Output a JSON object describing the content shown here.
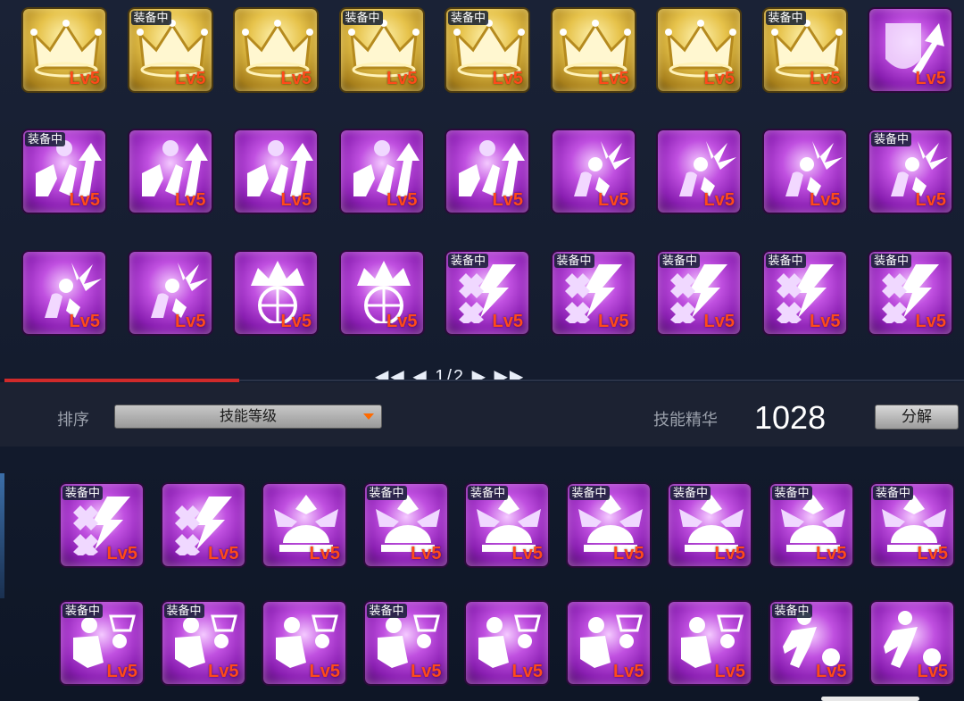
{
  "top_grid": {
    "rows": [
      [
        {
          "style": "gold",
          "icon": "crown-icon",
          "level": "Lv5",
          "equipped": false
        },
        {
          "style": "gold",
          "icon": "crown-icon",
          "level": "Lv5",
          "equipped": true
        },
        {
          "style": "gold",
          "icon": "crown-icon",
          "level": "Lv5",
          "equipped": false
        },
        {
          "style": "gold",
          "icon": "crown-icon",
          "level": "Lv5",
          "equipped": true
        },
        {
          "style": "gold",
          "icon": "crown-icon",
          "level": "Lv5",
          "equipped": true
        },
        {
          "style": "gold",
          "icon": "crown-icon",
          "level": "Lv5",
          "equipped": false
        },
        {
          "style": "gold",
          "icon": "crown-icon",
          "level": "Lv5",
          "equipped": false
        },
        {
          "style": "gold",
          "icon": "crown-icon",
          "level": "Lv5",
          "equipped": true
        },
        {
          "style": "purple",
          "icon": "shield-arrow-icon",
          "level": "Lv5",
          "equipped": false
        }
      ],
      [
        {
          "style": "purple",
          "icon": "rebound-up-icon",
          "level": "Lv5",
          "equipped": true
        },
        {
          "style": "purple",
          "icon": "rebound-up-icon",
          "level": "Lv5",
          "equipped": false
        },
        {
          "style": "purple",
          "icon": "rebound-up-icon",
          "level": "Lv5",
          "equipped": false
        },
        {
          "style": "purple",
          "icon": "rebound-up-icon",
          "level": "Lv5",
          "equipped": false
        },
        {
          "style": "purple",
          "icon": "rebound-up-icon",
          "level": "Lv5",
          "equipped": false
        },
        {
          "style": "purple",
          "icon": "player-burst-icon",
          "level": "Lv5",
          "equipped": false
        },
        {
          "style": "purple",
          "icon": "player-burst-icon",
          "level": "Lv5",
          "equipped": false
        },
        {
          "style": "purple",
          "icon": "player-burst-icon",
          "level": "Lv5",
          "equipped": false
        },
        {
          "style": "purple",
          "icon": "player-burst-icon",
          "level": "Lv5",
          "equipped": true
        }
      ],
      [
        {
          "style": "purple",
          "icon": "player-burst-icon",
          "level": "Lv5",
          "equipped": false
        },
        {
          "style": "purple",
          "icon": "player-burst-icon",
          "level": "Lv5",
          "equipped": false
        },
        {
          "style": "purple",
          "icon": "crown-ball-icon",
          "level": "Lv5",
          "equipped": false
        },
        {
          "style": "purple",
          "icon": "crown-ball-icon",
          "level": "Lv5",
          "equipped": false
        },
        {
          "style": "purple",
          "icon": "lightning-cross-icon",
          "level": "Lv5",
          "equipped": true
        },
        {
          "style": "purple",
          "icon": "lightning-cross-icon",
          "level": "Lv5",
          "equipped": true
        },
        {
          "style": "purple",
          "icon": "lightning-cross-icon",
          "level": "Lv5",
          "equipped": true
        },
        {
          "style": "purple",
          "icon": "lightning-cross-icon",
          "level": "Lv5",
          "equipped": true
        },
        {
          "style": "purple",
          "icon": "lightning-cross-icon",
          "level": "Lv5",
          "equipped": true
        }
      ]
    ],
    "equipped_label": "装备中"
  },
  "pager": {
    "text": "◀◀ ◀  1/2  ▶ ▶▶"
  },
  "toolbar": {
    "sort_label": "排序",
    "sort_value": "技能等级",
    "essence_label": "技能精华",
    "essence_value": "1028",
    "decompose_label": "分解"
  },
  "bottom_grid": {
    "rows": [
      [
        {
          "style": "purple",
          "icon": "lightning-cross-icon",
          "level": "Lv5",
          "equipped": true
        },
        {
          "style": "purple",
          "icon": "lightning-cross-icon",
          "level": "Lv5",
          "equipped": false
        },
        {
          "style": "purple",
          "icon": "fan-ball-icon",
          "level": "Lv5",
          "equipped": false
        },
        {
          "style": "purple",
          "icon": "fan-ball-icon",
          "level": "Lv5",
          "equipped": true
        },
        {
          "style": "purple",
          "icon": "fan-ball-icon",
          "level": "Lv5",
          "equipped": true
        },
        {
          "style": "purple",
          "icon": "fan-ball-icon",
          "level": "Lv5",
          "equipped": true
        },
        {
          "style": "purple",
          "icon": "fan-ball-icon",
          "level": "Lv5",
          "equipped": true
        },
        {
          "style": "purple",
          "icon": "fan-ball-icon",
          "level": "Lv5",
          "equipped": true
        },
        {
          "style": "purple",
          "icon": "fan-ball-icon",
          "level": "Lv5",
          "equipped": true
        }
      ],
      [
        {
          "style": "purple",
          "icon": "dunk-hoop-icon",
          "level": "Lv5",
          "equipped": true
        },
        {
          "style": "purple",
          "icon": "dunk-hoop-icon",
          "level": "Lv5",
          "equipped": true
        },
        {
          "style": "purple",
          "icon": "dunk-hoop-icon",
          "level": "Lv5",
          "equipped": false
        },
        {
          "style": "purple",
          "icon": "dunk-hoop-icon",
          "level": "Lv5",
          "equipped": true
        },
        {
          "style": "purple",
          "icon": "dunk-hoop-icon",
          "level": "Lv5",
          "equipped": false
        },
        {
          "style": "purple",
          "icon": "dunk-hoop-icon",
          "level": "Lv5",
          "equipped": false
        },
        {
          "style": "purple",
          "icon": "dunk-hoop-icon",
          "level": "Lv5",
          "equipped": false
        },
        {
          "style": "purple",
          "icon": "crossover-dribble-icon",
          "level": "Lv5",
          "equipped": true
        },
        {
          "style": "purple",
          "icon": "crossover-dribble-icon",
          "level": "Lv5",
          "equipped": false
        }
      ]
    ]
  },
  "colors": {
    "level_text": "#ff4a1a",
    "accent_red": "#d02a2a",
    "gold_card": "#e6c24a",
    "purple_card": "#c050e0"
  }
}
